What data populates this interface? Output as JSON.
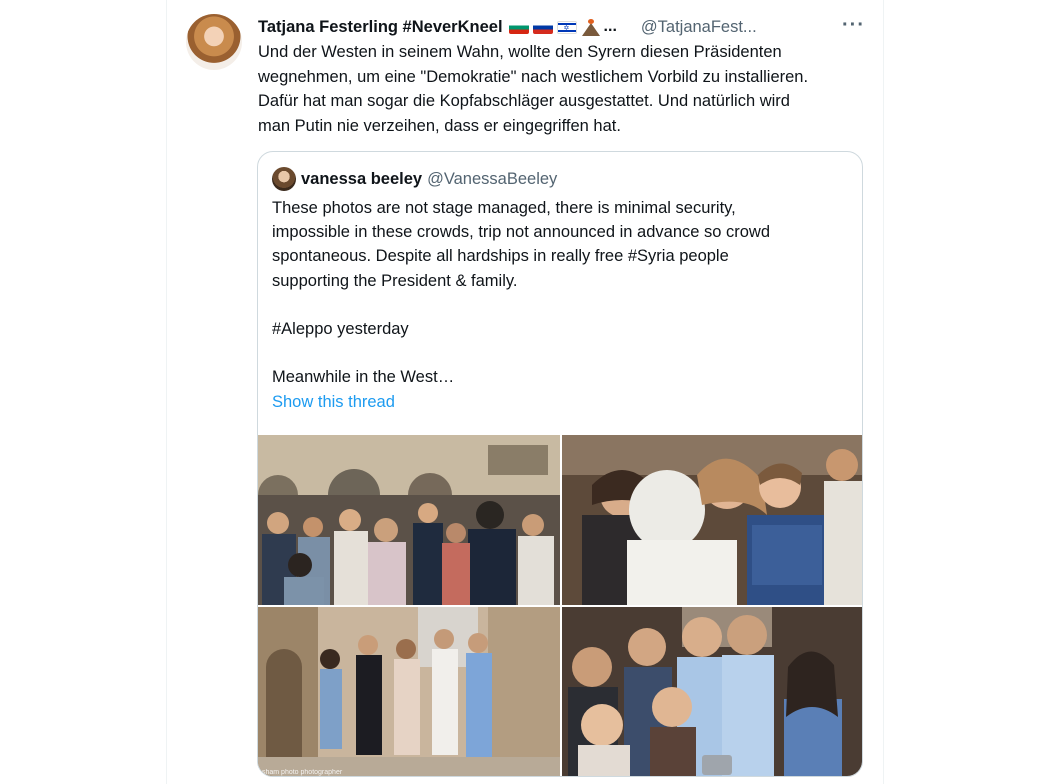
{
  "tweet": {
    "author_name": "Tatjana Festerling #NeverKneel",
    "flag_icons": [
      "bulgaria-flag",
      "russia-flag",
      "israel-flag",
      "volcano-emoji"
    ],
    "name_ellipsis": "...",
    "handle": "@TatjanaFest...",
    "more_label": "···",
    "text_lines": [
      "Und der Westen in seinem Wahn, wollte den Syrern diesen Präsidenten",
      "wegnehmen, um eine \"Demokratie\" nach westlichem Vorbild zu installieren.",
      "Dafür hat man sogar die Kopfabschläger ausgestattet. Und natürlich wird",
      "man Putin nie verzeihen, dass er eingegriffen hat."
    ]
  },
  "quoted_tweet": {
    "author_name": "vanessa beeley",
    "handle": "@VanessaBeeley",
    "paragraph_1_lines": [
      "These photos are not stage managed, there is minimal security,",
      "impossible in these crowds, trip not announced in advance so crowd",
      "spontaneous. Despite all hardships in really free #Syria people",
      "supporting the President & family."
    ],
    "paragraph_2": "#Aleppo yesterday",
    "paragraph_3": "Meanwhile in the West…",
    "show_thread_label": "Show this thread",
    "link_color": "#1d9bf0",
    "photos": [
      {
        "name": "photo-crowd-square"
      },
      {
        "name": "photo-boy-embrace"
      },
      {
        "name": "photo-family-walk",
        "caption": "sham photo photographer"
      },
      {
        "name": "photo-young-men-selfie"
      }
    ]
  }
}
